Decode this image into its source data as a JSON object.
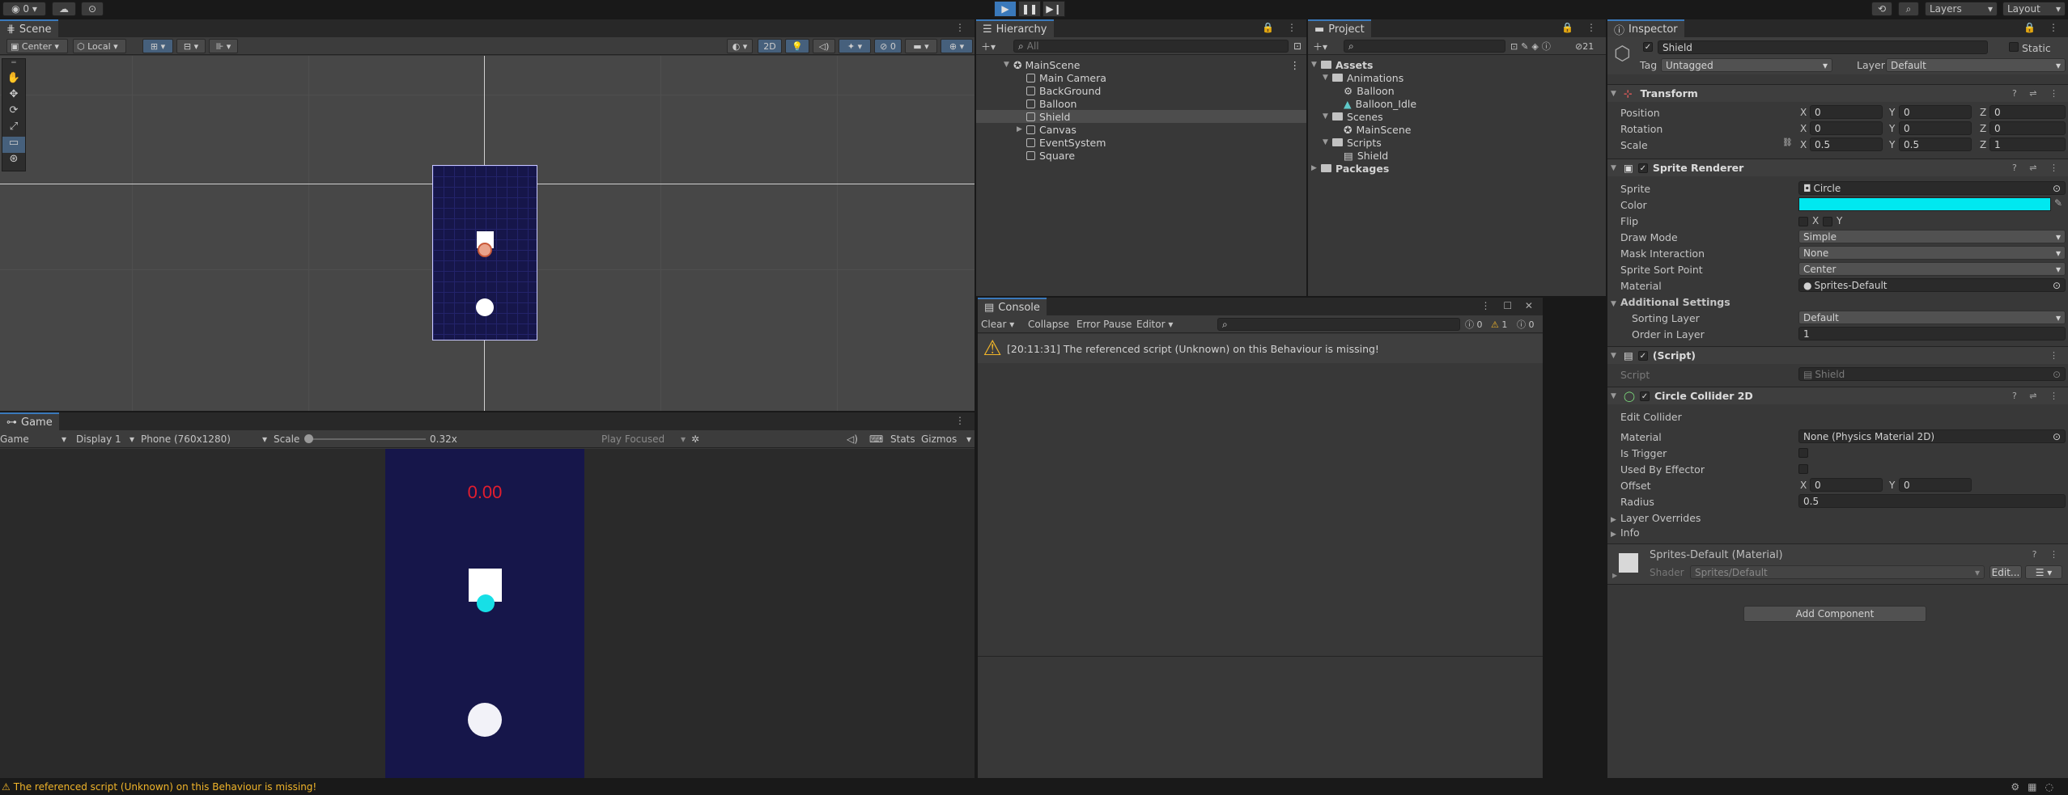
{
  "topbar": {
    "account": "0",
    "layers": "Layers",
    "layout": "Layout"
  },
  "scene": {
    "tab": "Scene",
    "pivot": "Center",
    "space": "Local",
    "mode2d": "2D"
  },
  "game": {
    "tab": "Game",
    "view": "Game",
    "display": "Display 1",
    "resolution": "Phone (760x1280)",
    "scale_label": "Scale",
    "scale_value": "0.32x",
    "play_focused": "Play Focused",
    "stats": "Stats",
    "gizmos": "Gizmos",
    "score": "0.00",
    "colors": {
      "bg": "#16164a",
      "score": "#e31d2e",
      "ball": "#17dfe6"
    }
  },
  "hierarchy": {
    "tab": "Hierarchy",
    "search_placeholder": "All",
    "scene_name": "MainScene",
    "items": [
      "Main Camera",
      "BackGround",
      "Balloon",
      "Shield",
      "Canvas",
      "EventSystem",
      "Square"
    ],
    "selected": "Shield"
  },
  "project": {
    "tab": "Project",
    "count": "21",
    "assets": "Assets",
    "animations": "Animations",
    "anim_items": [
      "Balloon",
      "Balloon_Idle"
    ],
    "scenes": "Scenes",
    "scene_items": [
      "MainScene"
    ],
    "scripts": "Scripts",
    "script_items": [
      "Shield"
    ],
    "packages": "Packages"
  },
  "console": {
    "tab": "Console",
    "clear": "Clear",
    "collapse": "Collapse",
    "error_pause": "Error Pause",
    "editor": "Editor",
    "count_info": "0",
    "count_warn": "1",
    "count_error": "0",
    "message": "[20:11:31] The referenced script (Unknown) on this Behaviour is missing!"
  },
  "inspector": {
    "tab": "Inspector",
    "object_name": "Shield",
    "static_label": "Static",
    "tag_label": "Tag",
    "tag_value": "Untagged",
    "layer_label": "Layer",
    "layer_value": "Default",
    "transform": {
      "title": "Transform",
      "position_label": "Position",
      "position": [
        "0",
        "0",
        "0"
      ],
      "rotation_label": "Rotation",
      "rotation": [
        "0",
        "0",
        "0"
      ],
      "scale_label": "Scale",
      "scale": [
        "0.5",
        "0.5",
        "1"
      ]
    },
    "sprite_renderer": {
      "title": "Sprite Renderer",
      "sprite_label": "Sprite",
      "sprite": "Circle",
      "color_label": "Color",
      "color": "#00e8f0",
      "flip_label": "Flip",
      "flip_x": "X",
      "flip_y": "Y",
      "draw_mode_label": "Draw Mode",
      "draw_mode": "Simple",
      "mask_label": "Mask Interaction",
      "mask": "None",
      "sort_point_label": "Sprite Sort Point",
      "sort_point": "Center",
      "material_label": "Material",
      "material": "Sprites-Default",
      "additional": "Additional Settings",
      "sorting_layer_label": "Sorting Layer",
      "sorting_layer": "Default",
      "order_label": "Order in Layer",
      "order": "1"
    },
    "script": {
      "title": "(Script)",
      "script_label": "Script",
      "script": "Shield"
    },
    "collider": {
      "title": "Circle Collider 2D",
      "edit": "Edit Collider",
      "material_label": "Material",
      "material": "None (Physics Material 2D)",
      "trigger_label": "Is Trigger",
      "effector_label": "Used By Effector",
      "offset_label": "Offset",
      "offset": [
        "0",
        "0"
      ],
      "radius_label": "Radius",
      "radius": "0.5",
      "layer_overrides": "Layer Overrides",
      "info": "Info"
    },
    "material": {
      "title": "Sprites-Default (Material)",
      "shader_label": "Shader",
      "shader": "Sprites/Default",
      "edit": "Edit..."
    },
    "add_component": "Add Component"
  },
  "status": {
    "message": "The referenced script (Unknown) on this Behaviour is missing!"
  }
}
